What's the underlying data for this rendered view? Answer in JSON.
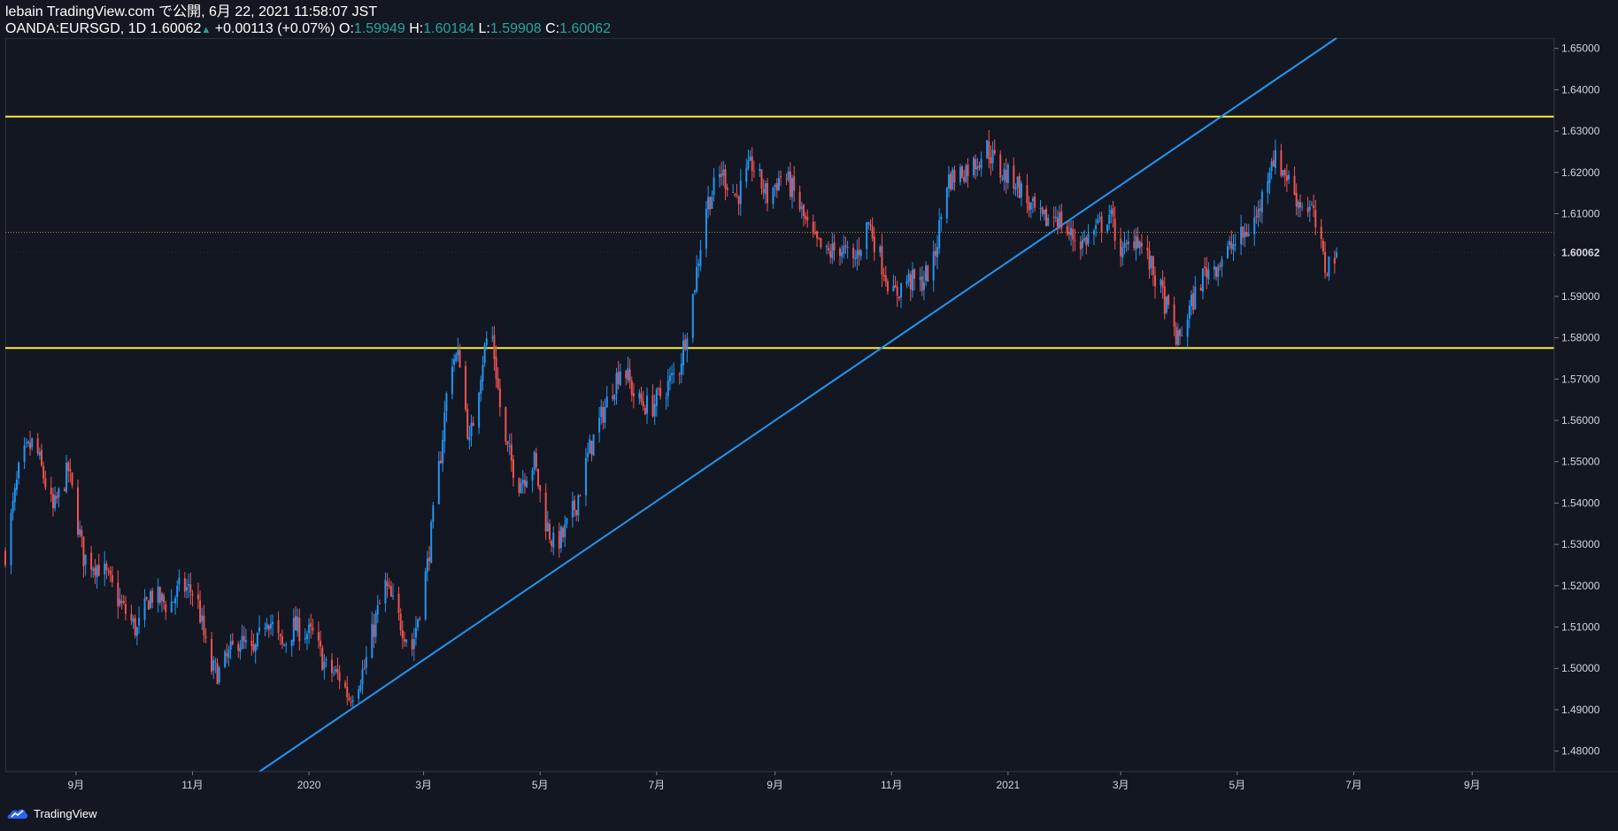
{
  "header": {
    "publish_line": "lebain TradingView.com で公開, 6月 22, 2021 11:58:07 JST",
    "symbol": "OANDA:EURSGD, 1D 1.60062",
    "change_arrow": "▲",
    "change": "+0.00113 (+0.07%)",
    "o_label": "O:",
    "o_value": "1.59949",
    "h_label": "H:",
    "h_value": "1.60184",
    "l_label": "L:",
    "l_value": "1.59908",
    "c_label": "C:",
    "c_value": "1.60062"
  },
  "price_axis": {
    "ticks": [
      "1.65000",
      "1.64000",
      "1.63000",
      "1.62000",
      "1.61000",
      "1.60000",
      "1.59000",
      "1.58000",
      "1.57000",
      "1.56000",
      "1.55000",
      "1.54000",
      "1.53000",
      "1.52000",
      "1.51000",
      "1.50000",
      "1.49000",
      "1.48000"
    ],
    "current_price_label": "1.60062"
  },
  "time_axis": {
    "labels": [
      "9月",
      "11月",
      "2020",
      "3月",
      "5月",
      "7月",
      "9月",
      "11月",
      "2021",
      "3月",
      "5月",
      "7月",
      "9月"
    ]
  },
  "footer": {
    "brand": "TradingView"
  },
  "colors": {
    "up": "#2196f3",
    "down": "#ef5350",
    "trendline": "#2196f3",
    "horizontal_line": "#ffeb3b",
    "background": "#131722"
  },
  "chart_data": {
    "type": "candlestick",
    "symbol": "OANDA:EURSGD",
    "interval": "1D",
    "ylim": [
      1.475,
      1.6525
    ],
    "horizontal_lines": [
      1.6335,
      1.5775
    ],
    "dotted_line": 1.6055,
    "trendline": {
      "from": [
        "2019-12-06",
        1.475
      ],
      "to": [
        "2021-06-22",
        1.6525
      ]
    },
    "anchors": [
      [
        "2019-07-26",
        1.528
      ],
      [
        "2019-08-03",
        1.55
      ],
      [
        "2019-08-10",
        1.555
      ],
      [
        "2019-08-20",
        1.538
      ],
      [
        "2019-08-28",
        1.548
      ],
      [
        "2019-09-05",
        1.527
      ],
      [
        "2019-09-15",
        1.524
      ],
      [
        "2019-09-25",
        1.515
      ],
      [
        "2019-10-03",
        1.509
      ],
      [
        "2019-10-10",
        1.518
      ],
      [
        "2019-10-20",
        1.515
      ],
      [
        "2019-10-26",
        1.52
      ],
      [
        "2019-11-03",
        1.518
      ],
      [
        "2019-11-10",
        1.5
      ],
      [
        "2019-11-15",
        1.499
      ],
      [
        "2019-11-25",
        1.507
      ],
      [
        "2019-12-03",
        1.503
      ],
      [
        "2019-12-10",
        1.513
      ],
      [
        "2019-12-18",
        1.505
      ],
      [
        "2019-12-24",
        1.51
      ],
      [
        "2020-01-03",
        1.508
      ],
      [
        "2020-01-10",
        1.5
      ],
      [
        "2020-01-17",
        1.498
      ],
      [
        "2020-01-22",
        1.493
      ],
      [
        "2020-01-30",
        1.5
      ],
      [
        "2020-02-05",
        1.512
      ],
      [
        "2020-02-10",
        1.52
      ],
      [
        "2020-02-17",
        1.512
      ],
      [
        "2020-02-24",
        1.505
      ],
      [
        "2020-03-03",
        1.525
      ],
      [
        "2020-03-10",
        1.552
      ],
      [
        "2020-03-15",
        1.575
      ],
      [
        "2020-03-20",
        1.575
      ],
      [
        "2020-03-25",
        1.554
      ],
      [
        "2020-04-01",
        1.575
      ],
      [
        "2020-04-05",
        1.584
      ],
      [
        "2020-04-12",
        1.555
      ],
      [
        "2020-04-20",
        1.545
      ],
      [
        "2020-04-28",
        1.55
      ],
      [
        "2020-05-03",
        1.537
      ],
      [
        "2020-05-08",
        1.53
      ],
      [
        "2020-05-13",
        1.532
      ],
      [
        "2020-05-20",
        1.54
      ],
      [
        "2020-05-27",
        1.553
      ],
      [
        "2020-06-03",
        1.562
      ],
      [
        "2020-06-08",
        1.568
      ],
      [
        "2020-06-13",
        1.574
      ],
      [
        "2020-06-20",
        1.565
      ],
      [
        "2020-06-28",
        1.563
      ],
      [
        "2020-07-06",
        1.568
      ],
      [
        "2020-07-13",
        1.573
      ],
      [
        "2020-07-20",
        1.59
      ],
      [
        "2020-07-27",
        1.612
      ],
      [
        "2020-08-04",
        1.62
      ],
      [
        "2020-08-12",
        1.614
      ],
      [
        "2020-08-20",
        1.622
      ],
      [
        "2020-08-28",
        1.614
      ],
      [
        "2020-09-05",
        1.62
      ],
      [
        "2020-09-12",
        1.614
      ],
      [
        "2020-09-20",
        1.604
      ],
      [
        "2020-09-28",
        1.6
      ],
      [
        "2020-10-05",
        1.602
      ],
      [
        "2020-10-12",
        1.598
      ],
      [
        "2020-10-20",
        1.608
      ],
      [
        "2020-10-27",
        1.598
      ],
      [
        "2020-11-02",
        1.59
      ],
      [
        "2020-11-09",
        1.594
      ],
      [
        "2020-11-16",
        1.593
      ],
      [
        "2020-11-23",
        1.598
      ],
      [
        "2020-11-30",
        1.618
      ],
      [
        "2020-12-07",
        1.62
      ],
      [
        "2020-12-14",
        1.622
      ],
      [
        "2020-12-21",
        1.626
      ],
      [
        "2020-12-28",
        1.62
      ],
      [
        "2021-01-05",
        1.618
      ],
      [
        "2021-01-12",
        1.612
      ],
      [
        "2021-01-19",
        1.608
      ],
      [
        "2021-01-26",
        1.61
      ],
      [
        "2021-02-02",
        1.605
      ],
      [
        "2021-02-09",
        1.603
      ],
      [
        "2021-02-16",
        1.606
      ],
      [
        "2021-02-23",
        1.61
      ],
      [
        "2021-03-02",
        1.6
      ],
      [
        "2021-03-09",
        1.605
      ],
      [
        "2021-03-16",
        1.598
      ],
      [
        "2021-03-23",
        1.59
      ],
      [
        "2021-03-31",
        1.579
      ],
      [
        "2021-04-07",
        1.588
      ],
      [
        "2021-04-14",
        1.596
      ],
      [
        "2021-04-21",
        1.598
      ],
      [
        "2021-04-28",
        1.602
      ],
      [
        "2021-05-05",
        1.605
      ],
      [
        "2021-05-12",
        1.61
      ],
      [
        "2021-05-19",
        1.624
      ],
      [
        "2021-05-26",
        1.62
      ],
      [
        "2021-06-02",
        1.613
      ],
      [
        "2021-06-09",
        1.611
      ],
      [
        "2021-06-16",
        1.597
      ],
      [
        "2021-06-22",
        1.6006
      ]
    ]
  }
}
